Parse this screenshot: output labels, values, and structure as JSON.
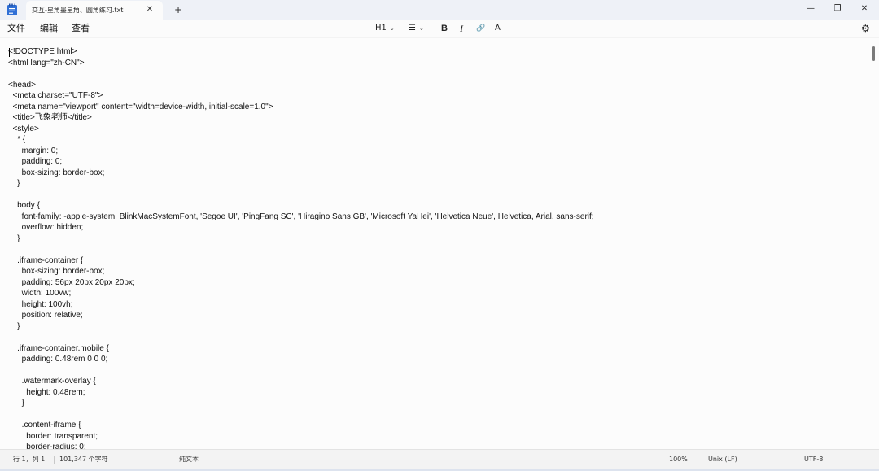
{
  "tab": {
    "title": "交互-星角墨星角、圆角练习.txt",
    "close_glyph": "✕",
    "add_glyph": "+"
  },
  "window": {
    "minimize": "—",
    "maximize": "❐",
    "close": "✕"
  },
  "menu": {
    "file": "文件",
    "edit": "编辑",
    "view": "查看"
  },
  "toolbar": {
    "heading": "H1",
    "list_glyph": "☰",
    "bold": "B",
    "italic": "I",
    "link_glyph": "🔗",
    "spell_glyph": "A",
    "settings_glyph": "⚙",
    "chevron": "⌄"
  },
  "document": {
    "lines": [
      "<!DOCTYPE html>",
      "<html lang=\"zh-CN\">",
      "",
      "<head>",
      "  <meta charset=\"UTF-8\">",
      "  <meta name=\"viewport\" content=\"width=device-width, initial-scale=1.0\">",
      "  <title>飞象老师</title>",
      "  <style>",
      "    * {",
      "      margin: 0;",
      "      padding: 0;",
      "      box-sizing: border-box;",
      "    }",
      "",
      "    body {",
      "      font-family: -apple-system, BlinkMacSystemFont, 'Segoe UI', 'PingFang SC', 'Hiragino Sans GB', 'Microsoft YaHei', 'Helvetica Neue', Helvetica, Arial, sans-serif;",
      "      overflow: hidden;",
      "    }",
      "",
      "    .iframe-container {",
      "      box-sizing: border-box;",
      "      padding: 56px 20px 20px 20px;",
      "      width: 100vw;",
      "      height: 100vh;",
      "      position: relative;",
      "    }",
      "",
      "    .iframe-container.mobile {",
      "      padding: 0.48rem 0 0 0;",
      "",
      "      .watermark-overlay {",
      "        height: 0.48rem;",
      "      }",
      "",
      "      .content-iframe {",
      "        border: transparent;",
      "        border-radius: 0;"
    ]
  },
  "status": {
    "position": "行 1，列 1",
    "chars": "101,347 个字符",
    "format": "纯文本",
    "zoom": "100%",
    "line_ending": "Unix (LF)",
    "encoding": "UTF-8"
  }
}
